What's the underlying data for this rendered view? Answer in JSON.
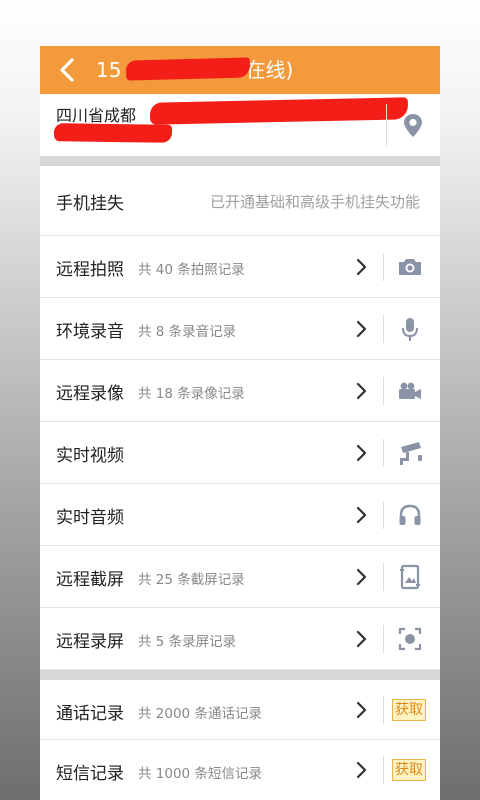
{
  "header": {
    "title_prefix": "15",
    "title_suffix": "在线)"
  },
  "address": {
    "text": "四川省成都"
  },
  "lost_phone": {
    "label": "手机挂失",
    "status": "已开通基础和高级手机挂失功能"
  },
  "features": [
    {
      "label": "远程拍照",
      "sub": "共 40 条拍照记录",
      "icon": "camera-icon"
    },
    {
      "label": "环境录音",
      "sub": "共 8 条录音记录",
      "icon": "microphone-icon"
    },
    {
      "label": "远程录像",
      "sub": "共 18 条录像记录",
      "icon": "video-camera-icon"
    },
    {
      "label": "实时视频",
      "sub": "",
      "icon": "cctv-camera-icon"
    },
    {
      "label": "实时音频",
      "sub": "",
      "icon": "headphones-icon"
    },
    {
      "label": "远程截屏",
      "sub": "共 25 条截屏记录",
      "icon": "screenshot-icon"
    },
    {
      "label": "远程录屏",
      "sub": "共 5 条录屏记录",
      "icon": "screen-record-icon"
    }
  ],
  "records": [
    {
      "label": "通话记录",
      "sub": "共 2000 条通话记录",
      "action": "获取"
    },
    {
      "label": "短信记录",
      "sub": "共 1000 条短信记录",
      "action": "获取"
    }
  ],
  "colors": {
    "accent": "#f39b3c",
    "redaction": "#f21e17",
    "icon_gray": "#8a94a6",
    "fetch_bg": "#fdf3c0",
    "fetch_text": "#e08a1e"
  }
}
